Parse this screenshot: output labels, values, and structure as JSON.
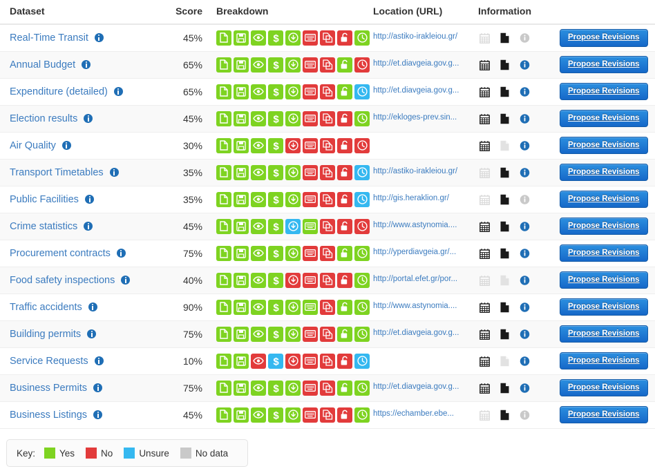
{
  "table": {
    "columns": [
      {
        "key": "dataset",
        "label": "Dataset"
      },
      {
        "key": "score",
        "label": "Score"
      },
      {
        "key": "breakdown",
        "label": "Breakdown"
      },
      {
        "key": "url",
        "label": "Location (URL)"
      },
      {
        "key": "information",
        "label": "Information"
      },
      {
        "key": "action",
        "label": ""
      }
    ],
    "action_label": "Propose Revisions",
    "breakdown_icons": [
      "file-icon",
      "save-icon",
      "eye-icon",
      "dollar-icon",
      "download-icon",
      "keyboard-icon",
      "copy-icon",
      "unlock-icon",
      "clock-icon"
    ],
    "information_icons": [
      "calendar-icon",
      "document-icon",
      "info-circle-icon"
    ],
    "rows": [
      {
        "dataset": "Real-Time Transit",
        "score": "45%",
        "breakdown": [
          "yes",
          "yes",
          "yes",
          "yes",
          "yes",
          "no",
          "no",
          "no",
          "yes"
        ],
        "url": "http://astiko-irakleiou.gr/",
        "information": [
          "none",
          "yes",
          "none"
        ]
      },
      {
        "dataset": "Annual Budget",
        "score": "65%",
        "breakdown": [
          "yes",
          "yes",
          "yes",
          "yes",
          "yes",
          "no",
          "no",
          "yes",
          "no"
        ],
        "url": "http://et.diavgeia.gov.g...",
        "information": [
          "yes",
          "yes",
          "yes"
        ]
      },
      {
        "dataset": "Expenditure (detailed)",
        "score": "65%",
        "breakdown": [
          "yes",
          "yes",
          "yes",
          "yes",
          "yes",
          "no",
          "no",
          "yes",
          "unsure"
        ],
        "url": "http://et.diavgeia.gov.g...",
        "information": [
          "yes",
          "yes",
          "yes"
        ]
      },
      {
        "dataset": "Election results",
        "score": "45%",
        "breakdown": [
          "yes",
          "yes",
          "yes",
          "yes",
          "yes",
          "no",
          "no",
          "no",
          "yes"
        ],
        "url": "http://ekloges-prev.sin...",
        "information": [
          "yes",
          "yes",
          "yes"
        ]
      },
      {
        "dataset": "Air Quality",
        "score": "30%",
        "breakdown": [
          "yes",
          "yes",
          "yes",
          "yes",
          "no",
          "no",
          "no",
          "no",
          "no"
        ],
        "url": "",
        "information": [
          "yes",
          "none",
          "yes"
        ]
      },
      {
        "dataset": "Transport Timetables",
        "score": "35%",
        "breakdown": [
          "yes",
          "yes",
          "yes",
          "yes",
          "yes",
          "no",
          "no",
          "no",
          "unsure"
        ],
        "url": "http://astiko-irakleiou.gr/",
        "information": [
          "none",
          "yes",
          "yes"
        ]
      },
      {
        "dataset": "Public Facilities",
        "score": "35%",
        "breakdown": [
          "yes",
          "yes",
          "yes",
          "yes",
          "yes",
          "no",
          "no",
          "no",
          "unsure"
        ],
        "url": "http://gis.heraklion.gr/",
        "information": [
          "none",
          "yes",
          "none"
        ]
      },
      {
        "dataset": "Crime statistics",
        "score": "45%",
        "breakdown": [
          "yes",
          "yes",
          "yes",
          "yes",
          "unsure",
          "yes",
          "no",
          "no",
          "no"
        ],
        "url": "http://www.astynomia....",
        "information": [
          "yes",
          "yes",
          "yes"
        ]
      },
      {
        "dataset": "Procurement contracts",
        "score": "75%",
        "breakdown": [
          "yes",
          "yes",
          "yes",
          "yes",
          "yes",
          "no",
          "no",
          "yes",
          "yes"
        ],
        "url": "http://yperdiavgeia.gr/...",
        "information": [
          "yes",
          "yes",
          "yes"
        ]
      },
      {
        "dataset": "Food safety inspections",
        "score": "40%",
        "breakdown": [
          "yes",
          "yes",
          "yes",
          "yes",
          "no",
          "no",
          "no",
          "no",
          "yes"
        ],
        "url": "http://portal.efet.gr/por...",
        "information": [
          "none",
          "none",
          "yes"
        ]
      },
      {
        "dataset": "Traffic accidents",
        "score": "90%",
        "breakdown": [
          "yes",
          "yes",
          "yes",
          "yes",
          "yes",
          "yes",
          "no",
          "yes",
          "yes"
        ],
        "url": "http://www.astynomia....",
        "information": [
          "yes",
          "yes",
          "yes"
        ]
      },
      {
        "dataset": "Building permits",
        "score": "75%",
        "breakdown": [
          "yes",
          "yes",
          "yes",
          "yes",
          "yes",
          "no",
          "no",
          "yes",
          "yes"
        ],
        "url": "http://et.diavgeia.gov.g...",
        "information": [
          "yes",
          "yes",
          "yes"
        ]
      },
      {
        "dataset": "Service Requests",
        "score": "10%",
        "breakdown": [
          "yes",
          "yes",
          "no",
          "unsure",
          "no",
          "no",
          "no",
          "no",
          "unsure"
        ],
        "url": "",
        "information": [
          "yes",
          "none",
          "yes"
        ]
      },
      {
        "dataset": "Business Permits",
        "score": "75%",
        "breakdown": [
          "yes",
          "yes",
          "yes",
          "yes",
          "yes",
          "no",
          "no",
          "yes",
          "yes"
        ],
        "url": "http://et.diavgeia.gov.g...",
        "information": [
          "yes",
          "yes",
          "yes"
        ]
      },
      {
        "dataset": "Business Listings",
        "score": "45%",
        "breakdown": [
          "yes",
          "yes",
          "yes",
          "yes",
          "yes",
          "no",
          "no",
          "no",
          "yes"
        ],
        "url": "https://echamber.ebe...",
        "information": [
          "none",
          "yes",
          "none"
        ]
      }
    ]
  },
  "key": {
    "label": "Key:",
    "items": [
      {
        "value": "yes",
        "label": "Yes",
        "color": "#7ed321"
      },
      {
        "value": "no",
        "label": "No",
        "color": "#e23b3b"
      },
      {
        "value": "unsure",
        "label": "Unsure",
        "color": "#35b8f0"
      },
      {
        "value": "none",
        "label": "No data",
        "color": "#c9c9c9"
      }
    ]
  }
}
